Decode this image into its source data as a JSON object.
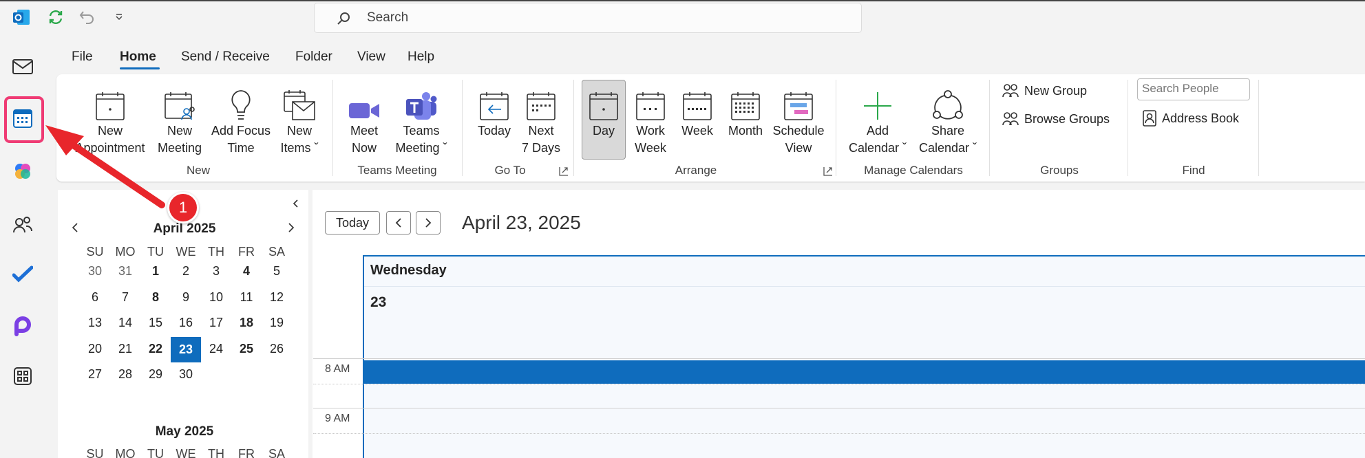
{
  "search": {
    "placeholder": "Search"
  },
  "menu": {
    "file": "File",
    "home": "Home",
    "send_receive": "Send / Receive",
    "folder": "Folder",
    "view": "View",
    "help": "Help"
  },
  "ribbon": {
    "new_appointment": [
      "New",
      "Appointment"
    ],
    "new_meeting": [
      "New",
      "Meeting"
    ],
    "add_focus_time": [
      "Add Focus",
      "Time"
    ],
    "new_items": [
      "New",
      "Items ˇ"
    ],
    "meet_now": [
      "Meet",
      "Now"
    ],
    "teams_meeting": [
      "Teams",
      "Meeting ˇ"
    ],
    "today": [
      "Today",
      ""
    ],
    "next_7_days": [
      "Next",
      "7 Days"
    ],
    "day": [
      "Day",
      ""
    ],
    "work_week": [
      "Work",
      "Week"
    ],
    "week": [
      "Week",
      ""
    ],
    "month": [
      "Month",
      ""
    ],
    "schedule_view": [
      "Schedule",
      "View"
    ],
    "add_calendar": [
      "Add",
      "Calendar ˇ"
    ],
    "share_calendar": [
      "Share",
      "Calendar ˇ"
    ],
    "new_group": "New Group",
    "browse_groups": "Browse Groups",
    "search_people": "Search People",
    "address_book": "Address Book",
    "groups": {
      "new": "New",
      "teams_meeting": "Teams Meeting",
      "go_to": "Go To",
      "arrange": "Arrange",
      "manage_calendars": "Manage Calendars",
      "groups": "Groups",
      "find": "Find"
    }
  },
  "annotation": {
    "marker": "1"
  },
  "mini_calendar": {
    "title": "April 2025",
    "weekdays": [
      "SU",
      "MO",
      "TU",
      "WE",
      "TH",
      "FR",
      "SA"
    ],
    "weeks": [
      [
        "30",
        "31",
        "1",
        "2",
        "3",
        "4",
        "5"
      ],
      [
        "6",
        "7",
        "8",
        "9",
        "10",
        "11",
        "12"
      ],
      [
        "13",
        "14",
        "15",
        "16",
        "17",
        "18",
        "19"
      ],
      [
        "20",
        "21",
        "22",
        "23",
        "24",
        "25",
        "26"
      ],
      [
        "27",
        "28",
        "29",
        "30",
        "",
        "",
        ""
      ]
    ],
    "next_title": "May 2025"
  },
  "calendar_view": {
    "today_button": "Today",
    "date_heading": "April 23, 2025",
    "day_name": "Wednesday",
    "day_number": "23",
    "times": [
      "8 AM",
      "9 AM"
    ]
  },
  "colors": {
    "accent": "#0f6cbd",
    "highlight": "#ef3b74",
    "arrow": "#e8262b"
  }
}
